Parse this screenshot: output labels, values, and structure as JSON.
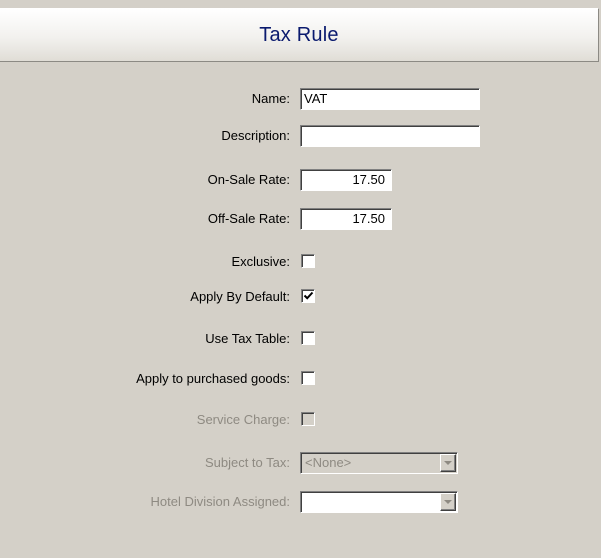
{
  "window": {
    "title": "Tax Rule"
  },
  "form": {
    "name": {
      "label": "Name:",
      "value": "VAT"
    },
    "description": {
      "label": "Description:",
      "value": ""
    },
    "on_sale_rate": {
      "label": "On-Sale Rate:",
      "value": "17.50"
    },
    "off_sale_rate": {
      "label": "Off-Sale Rate:",
      "value": "17.50"
    },
    "exclusive": {
      "label": "Exclusive:",
      "checked": false
    },
    "apply_by_default": {
      "label": "Apply By Default:",
      "checked": true
    },
    "use_tax_table": {
      "label": "Use Tax Table:",
      "checked": false
    },
    "apply_to_purchased_goods": {
      "label": "Apply to purchased goods:",
      "checked": false
    },
    "service_charge": {
      "label": "Service Charge:",
      "checked": false,
      "disabled": true
    },
    "subject_to_tax": {
      "label": "Subject to Tax:",
      "value": "<None>",
      "disabled": true
    },
    "hotel_division_assigned": {
      "label": "Hotel Division Assigned:",
      "value": "",
      "disabled": true
    }
  },
  "colors": {
    "title_text": "#0a1a6e",
    "panel_bg": "#d4d0c8",
    "disabled_text": "#8e8a82"
  },
  "icons": {
    "checkmark": "checkmark-icon",
    "dropdown": "chevron-down-icon"
  }
}
